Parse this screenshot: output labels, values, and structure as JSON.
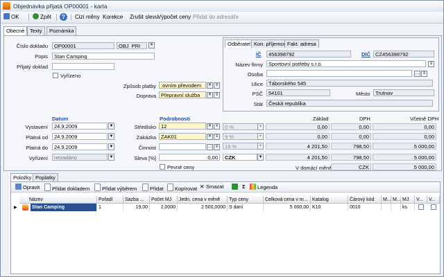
{
  "window": {
    "title": "Objednávka přijatá OP00001 - karta"
  },
  "toolbar": {
    "ok": "OK",
    "back": "Zpět",
    "help": "?",
    "foreign_currency": "Cizí měny",
    "correction": "Korekce",
    "cancel_discount": "Zrušit slevu",
    "calc_prices": "Výpočet ceny",
    "add_to_addressbook": "Přidat do adresáře"
  },
  "tabs": [
    "Obecné",
    "Texty",
    "Poznámka"
  ],
  "general": {
    "doc_number_label": "Číslo dokladu",
    "doc_number": "OP00001",
    "doc_series": "OBJ_PRI",
    "description_label": "Popis",
    "description": "Stan Camping",
    "received_doc_label": "Přijatý doklad",
    "received_doc": "",
    "settled_label": "Vyřízeno",
    "payment_label": "Způsob platby",
    "payment_value": ":ovním převodem",
    "transport_label": "Doprava",
    "transport_value": "Přepravní služba"
  },
  "partner": {
    "tabs": [
      "Odběratel",
      "Kon. příjemce",
      "Fakt. adresa"
    ],
    "ic_label": "IČ",
    "ic": "456398792",
    "dic_label": "DIČ",
    "dic": "CZ456398792",
    "company_label": "Název firmy",
    "company": "Sportovní potřeby s.r.o.",
    "person_label": "Osoba",
    "person": "",
    "street_label": "Ulice",
    "street": "Táborského 545",
    "zip_label": "PSČ",
    "zip": "54101",
    "city_label": "Město",
    "city": "Trutnov",
    "country_label": "Stát",
    "country": "Česká republika"
  },
  "dates": {
    "heading": "Datum",
    "issued_label": "Vystavení",
    "issued": "24.9.2009",
    "valid_from_label": "Platná od",
    "valid_from": "24.9.2009",
    "valid_to_label": "Platná do",
    "valid_to": "24.9.2009",
    "settled_label": "Vyřízení",
    "settled": "nezadáno"
  },
  "details": {
    "heading": "Podrobnosti",
    "center_label": "Středisko",
    "center": "12",
    "order_label": "Zakázka",
    "order": "ZAK01",
    "activity_label": "Činnost",
    "activity": "",
    "discount_label": "Sleva [%]",
    "discount": "0,00",
    "fixed_prices_label": "Pevné ceny",
    "currency": "CZK"
  },
  "totals": {
    "base_label": "Základ",
    "vat_label": "DPH",
    "incl_vat_label": "Včetně DPH",
    "rows": [
      {
        "rate": "0 %",
        "base": "0,00",
        "vat": "0,00",
        "total": "0,00"
      },
      {
        "rate": "9 %",
        "base": "0,00",
        "vat": "0,00",
        "total": "0,00"
      },
      {
        "rate": "19 %",
        "base": "4 201,50",
        "vat": "798,50",
        "total": "5 000,00"
      }
    ],
    "sum": {
      "base": "4 201,50",
      "vat": "798,50",
      "total": "5 000,00"
    },
    "domestic_label": "V domácí měně",
    "domestic_currency": "CZK",
    "domestic_total": "5 000,00"
  },
  "bottom_tabs": [
    "Položky",
    "Poplatky"
  ],
  "grid_toolbar": {
    "edit": "Opravit",
    "add_by_doc": "Přidat dokladem",
    "add_by_select": "Přidat výběrem",
    "add": "Přidat",
    "copy": "Kopírovat",
    "delete": "Smazat",
    "sigma": "Σ",
    "legend": "Legenda"
  },
  "grid": {
    "columns": [
      "Název",
      "Pořadí",
      "Sazba ...",
      "Počet MJ",
      "Jedn. cena v měně",
      "Typ ceny",
      "Celková cena v m...",
      "Katalog",
      "Čárový kód",
      "M...",
      "M...",
      "MJ",
      "V...",
      "V..."
    ],
    "rows": [
      {
        "name": "Stan Camping",
        "order": "1",
        "rate": "19,00",
        "qty": "2,0000",
        "unit_price": "2 500,0000",
        "price_type": "S daní",
        "total": "5 000,00",
        "catalog": "K10",
        "barcode": "0010",
        "m1": "",
        "m2": "",
        "mj": "ks"
      }
    ]
  },
  "colors": {
    "accent": "#1f4eaa",
    "header": "#dfe6f0",
    "selection": "#2a4f8f",
    "required": "#fff6cc"
  }
}
